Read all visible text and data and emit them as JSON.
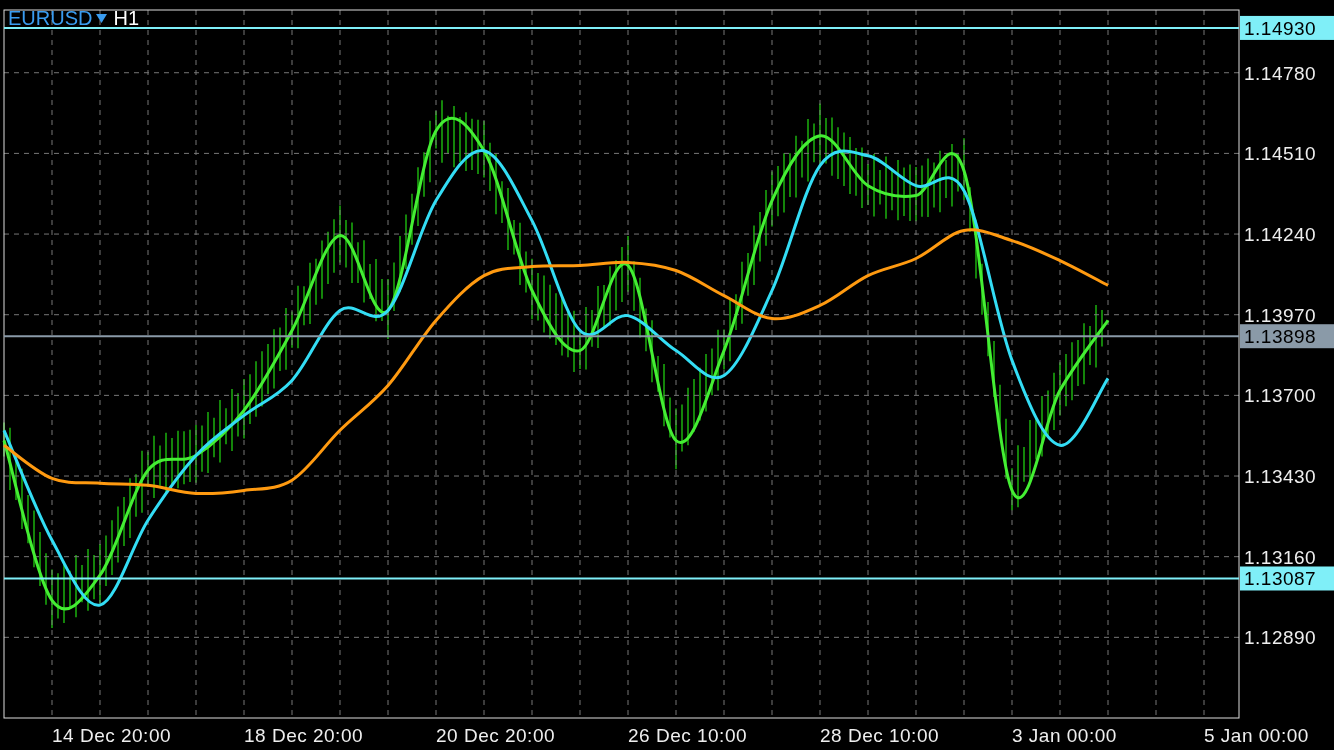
{
  "header": {
    "symbol": "EURUSD",
    "timeframe": "H1"
  },
  "chart_data": {
    "type": "line",
    "grid": true,
    "categories": [
      null,
      null,
      "14 Dec 20:00",
      null,
      null,
      null,
      "18 Dec 20:00",
      null,
      null,
      null,
      "20 Dec 20:00",
      null,
      null,
      null,
      "26 Dec 10:00",
      null,
      null,
      null,
      "28 Dec 10:00",
      null,
      null,
      null,
      "3 Jan 00:00",
      null,
      null,
      null,
      "5 Jan 00:00"
    ],
    "series": [
      {
        "color": "#44ee33",
        "values": [
          1.13549,
          1.13014,
          1.13098,
          1.13449,
          1.13499,
          1.1365,
          1.13917,
          1.14235,
          1.13984,
          1.14586,
          1.14519,
          1.14051,
          1.1385,
          1.14135,
          1.13549,
          1.1385,
          1.14352,
          1.14569,
          1.14402,
          1.14369,
          1.14452,
          1.13382,
          1.13717,
          1.13951,
          null,
          null,
          null
        ]
      },
      {
        "color": "#33ddf5",
        "values": [
          1.13583,
          1.13215,
          1.12998,
          1.13282,
          1.13499,
          1.13633,
          1.1375,
          1.13984,
          1.13984,
          1.14352,
          1.14519,
          1.14285,
          1.13917,
          1.13967,
          1.1385,
          1.13767,
          1.14051,
          1.14469,
          1.14502,
          1.14402,
          1.14385,
          1.13817,
          1.13533,
          1.13757,
          null,
          null,
          null
        ]
      },
      {
        "color": "#ff9a10",
        "values": [
          1.13533,
          1.13422,
          1.13406,
          1.13399,
          1.13372,
          1.13382,
          1.13416,
          1.13583,
          1.13733,
          1.13951,
          1.14101,
          1.14131,
          1.14135,
          1.14145,
          1.14118,
          1.14034,
          1.13957,
          1.14001,
          1.14101,
          1.14158,
          1.14252,
          1.14218,
          1.14151,
          1.14068,
          null,
          null,
          null
        ]
      }
    ],
    "ref_lines": [
      {
        "axis": "y",
        "value": 1.1493,
        "label": "1.14930",
        "color": "#7feff8"
      },
      {
        "axis": "y",
        "value": 1.13898,
        "label": "1.13898",
        "color": "#8a9aa8"
      },
      {
        "axis": "y",
        "value": 1.13087,
        "label": "1.13087",
        "color": "#7feff8"
      }
    ],
    "ylim": [
      1.1262,
      1.1499
    ],
    "yticks": [
      {
        "value": 1.1478,
        "label": "1.14780"
      },
      {
        "value": 1.1451,
        "label": "1.14510"
      },
      {
        "value": 1.1424,
        "label": "1.14240"
      },
      {
        "value": 1.1397,
        "label": "1.13970"
      },
      {
        "value": 1.137,
        "label": "1.13700"
      },
      {
        "value": 1.1343,
        "label": "1.13430"
      },
      {
        "value": 1.1316,
        "label": "1.13160"
      },
      {
        "value": 1.1289,
        "label": "1.12890"
      }
    ]
  }
}
